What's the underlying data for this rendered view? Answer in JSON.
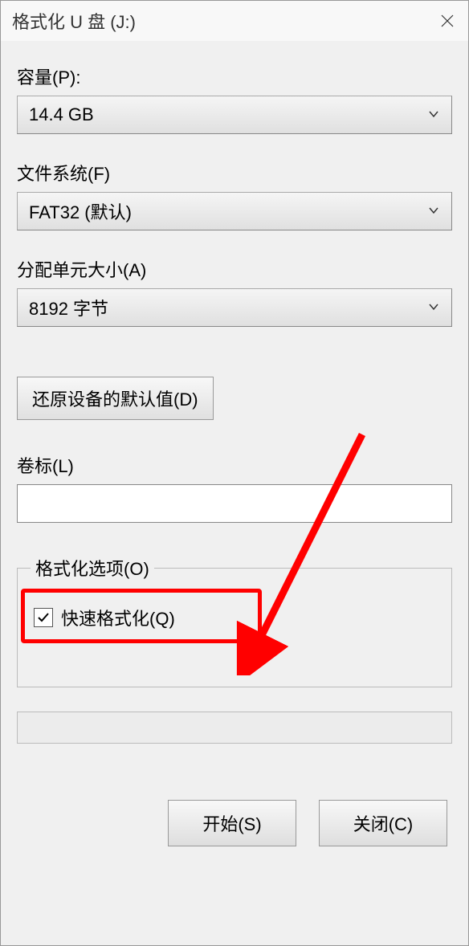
{
  "titlebar": {
    "title": "格式化 U 盘 (J:)"
  },
  "fields": {
    "capacity": {
      "label": "容量(P):",
      "value": "14.4 GB"
    },
    "filesystem": {
      "label": "文件系统(F)",
      "value": "FAT32 (默认)"
    },
    "allocation": {
      "label": "分配单元大小(A)",
      "value": "8192 字节"
    },
    "restore_defaults_button": "还原设备的默认值(D)",
    "volume_label": {
      "label": "卷标(L)",
      "value": ""
    }
  },
  "format_options": {
    "legend": "格式化选项(O)",
    "quick_format": {
      "label": "快速格式化(Q)",
      "checked": true
    }
  },
  "footer": {
    "start": "开始(S)",
    "close": "关闭(C)"
  }
}
